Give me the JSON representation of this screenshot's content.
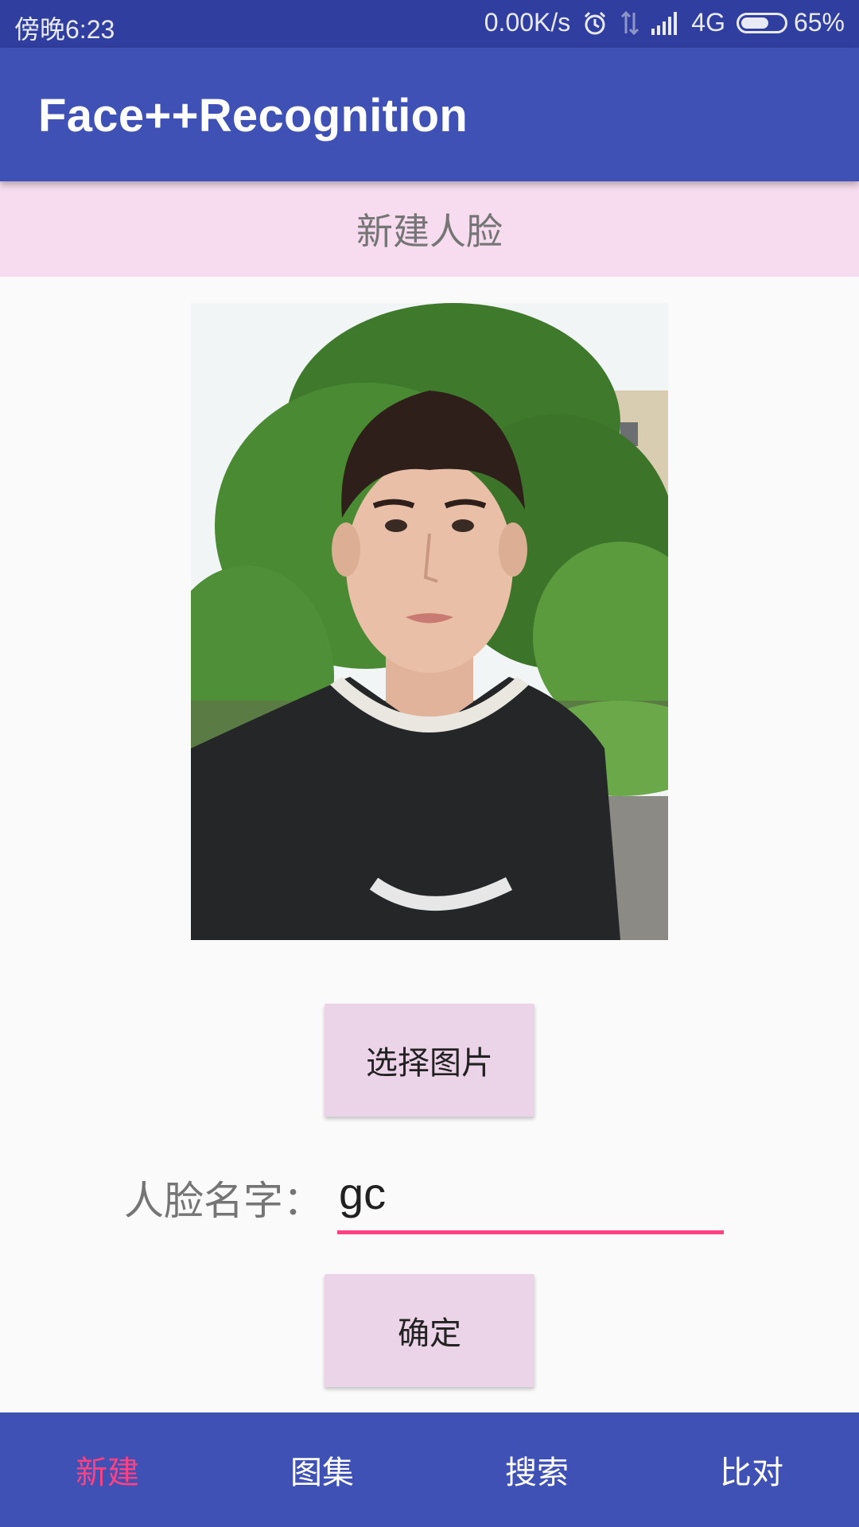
{
  "status_bar": {
    "time": "傍晚6:23",
    "net_speed": "0.00K/s",
    "network": "4G",
    "battery_percent": "65%",
    "battery_level": 0.65,
    "icons": [
      "alarm-icon",
      "data-arrows-icon",
      "signal-icon",
      "battery-icon"
    ]
  },
  "app_bar": {
    "title": "Face++Recognition"
  },
  "section": {
    "title": "新建人脸"
  },
  "photo": {
    "icon": "face-photo"
  },
  "buttons": {
    "select_image": "选择图片",
    "confirm": "确定"
  },
  "form": {
    "name_label": "人脸名字：",
    "name_value": "gc"
  },
  "bottom_nav": {
    "items": [
      {
        "label": "新建",
        "active": true
      },
      {
        "label": "图集",
        "active": false
      },
      {
        "label": "搜索",
        "active": false
      },
      {
        "label": "比对",
        "active": false
      }
    ]
  },
  "colors": {
    "status_bar": "#303f9f",
    "primary": "#3f51b5",
    "accent": "#ff4081",
    "header_bg": "#f6dcee",
    "button_bg": "#ecd4e8"
  }
}
